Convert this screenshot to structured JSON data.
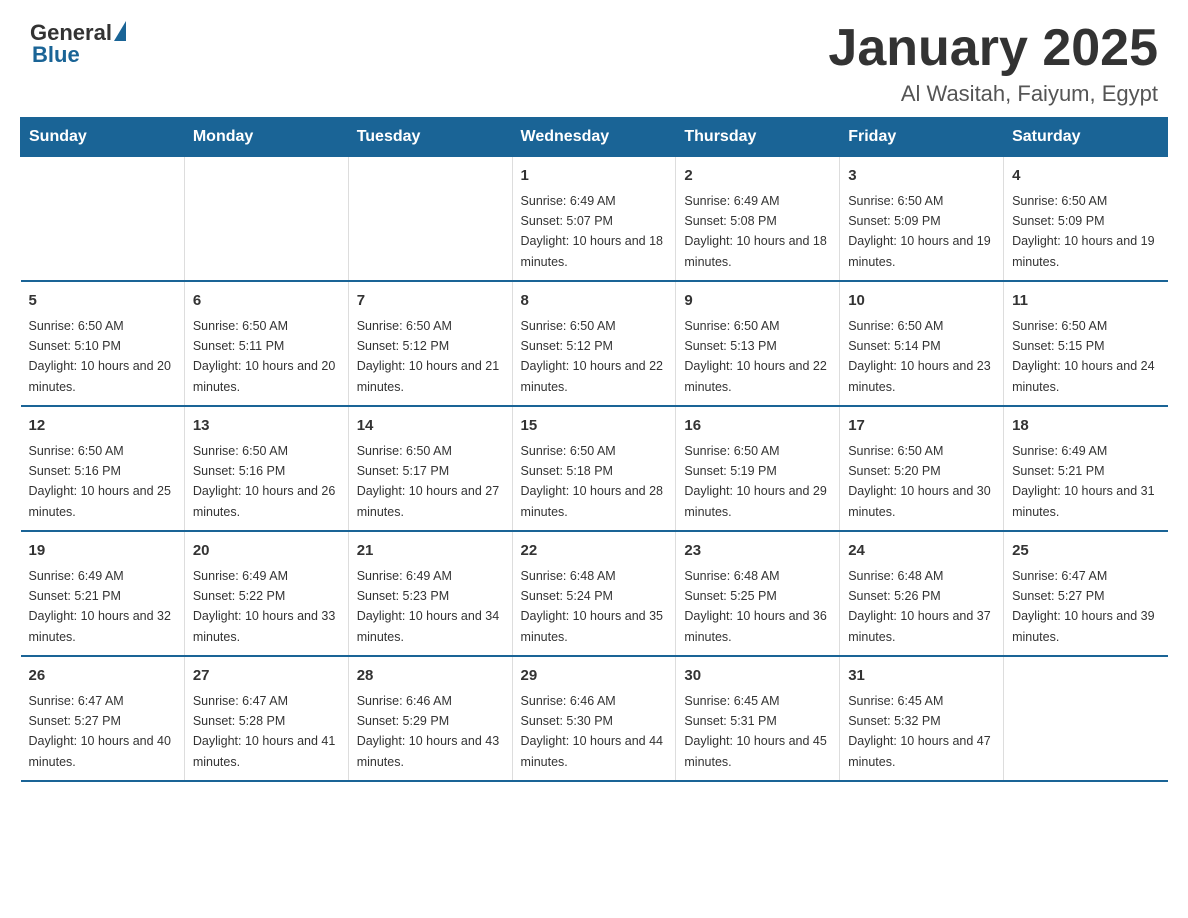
{
  "header": {
    "logo_general": "General",
    "logo_blue": "Blue",
    "month_title": "January 2025",
    "location": "Al Wasitah, Faiyum, Egypt"
  },
  "days_of_week": [
    "Sunday",
    "Monday",
    "Tuesday",
    "Wednesday",
    "Thursday",
    "Friday",
    "Saturday"
  ],
  "weeks": [
    [
      null,
      null,
      null,
      {
        "day": "1",
        "sunrise": "6:49 AM",
        "sunset": "5:07 PM",
        "daylight": "10 hours and 18 minutes."
      },
      {
        "day": "2",
        "sunrise": "6:49 AM",
        "sunset": "5:08 PM",
        "daylight": "10 hours and 18 minutes."
      },
      {
        "day": "3",
        "sunrise": "6:50 AM",
        "sunset": "5:09 PM",
        "daylight": "10 hours and 19 minutes."
      },
      {
        "day": "4",
        "sunrise": "6:50 AM",
        "sunset": "5:09 PM",
        "daylight": "10 hours and 19 minutes."
      }
    ],
    [
      {
        "day": "5",
        "sunrise": "6:50 AM",
        "sunset": "5:10 PM",
        "daylight": "10 hours and 20 minutes."
      },
      {
        "day": "6",
        "sunrise": "6:50 AM",
        "sunset": "5:11 PM",
        "daylight": "10 hours and 20 minutes."
      },
      {
        "day": "7",
        "sunrise": "6:50 AM",
        "sunset": "5:12 PM",
        "daylight": "10 hours and 21 minutes."
      },
      {
        "day": "8",
        "sunrise": "6:50 AM",
        "sunset": "5:12 PM",
        "daylight": "10 hours and 22 minutes."
      },
      {
        "day": "9",
        "sunrise": "6:50 AM",
        "sunset": "5:13 PM",
        "daylight": "10 hours and 22 minutes."
      },
      {
        "day": "10",
        "sunrise": "6:50 AM",
        "sunset": "5:14 PM",
        "daylight": "10 hours and 23 minutes."
      },
      {
        "day": "11",
        "sunrise": "6:50 AM",
        "sunset": "5:15 PM",
        "daylight": "10 hours and 24 minutes."
      }
    ],
    [
      {
        "day": "12",
        "sunrise": "6:50 AM",
        "sunset": "5:16 PM",
        "daylight": "10 hours and 25 minutes."
      },
      {
        "day": "13",
        "sunrise": "6:50 AM",
        "sunset": "5:16 PM",
        "daylight": "10 hours and 26 minutes."
      },
      {
        "day": "14",
        "sunrise": "6:50 AM",
        "sunset": "5:17 PM",
        "daylight": "10 hours and 27 minutes."
      },
      {
        "day": "15",
        "sunrise": "6:50 AM",
        "sunset": "5:18 PM",
        "daylight": "10 hours and 28 minutes."
      },
      {
        "day": "16",
        "sunrise": "6:50 AM",
        "sunset": "5:19 PM",
        "daylight": "10 hours and 29 minutes."
      },
      {
        "day": "17",
        "sunrise": "6:50 AM",
        "sunset": "5:20 PM",
        "daylight": "10 hours and 30 minutes."
      },
      {
        "day": "18",
        "sunrise": "6:49 AM",
        "sunset": "5:21 PM",
        "daylight": "10 hours and 31 minutes."
      }
    ],
    [
      {
        "day": "19",
        "sunrise": "6:49 AM",
        "sunset": "5:21 PM",
        "daylight": "10 hours and 32 minutes."
      },
      {
        "day": "20",
        "sunrise": "6:49 AM",
        "sunset": "5:22 PM",
        "daylight": "10 hours and 33 minutes."
      },
      {
        "day": "21",
        "sunrise": "6:49 AM",
        "sunset": "5:23 PM",
        "daylight": "10 hours and 34 minutes."
      },
      {
        "day": "22",
        "sunrise": "6:48 AM",
        "sunset": "5:24 PM",
        "daylight": "10 hours and 35 minutes."
      },
      {
        "day": "23",
        "sunrise": "6:48 AM",
        "sunset": "5:25 PM",
        "daylight": "10 hours and 36 minutes."
      },
      {
        "day": "24",
        "sunrise": "6:48 AM",
        "sunset": "5:26 PM",
        "daylight": "10 hours and 37 minutes."
      },
      {
        "day": "25",
        "sunrise": "6:47 AM",
        "sunset": "5:27 PM",
        "daylight": "10 hours and 39 minutes."
      }
    ],
    [
      {
        "day": "26",
        "sunrise": "6:47 AM",
        "sunset": "5:27 PM",
        "daylight": "10 hours and 40 minutes."
      },
      {
        "day": "27",
        "sunrise": "6:47 AM",
        "sunset": "5:28 PM",
        "daylight": "10 hours and 41 minutes."
      },
      {
        "day": "28",
        "sunrise": "6:46 AM",
        "sunset": "5:29 PM",
        "daylight": "10 hours and 43 minutes."
      },
      {
        "day": "29",
        "sunrise": "6:46 AM",
        "sunset": "5:30 PM",
        "daylight": "10 hours and 44 minutes."
      },
      {
        "day": "30",
        "sunrise": "6:45 AM",
        "sunset": "5:31 PM",
        "daylight": "10 hours and 45 minutes."
      },
      {
        "day": "31",
        "sunrise": "6:45 AM",
        "sunset": "5:32 PM",
        "daylight": "10 hours and 47 minutes."
      },
      null
    ]
  ]
}
